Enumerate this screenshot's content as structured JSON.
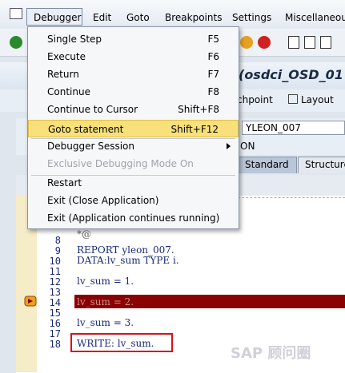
{
  "menubar": {
    "items": [
      "Debugger",
      "Edit",
      "Goto",
      "Breakpoints",
      "Settings",
      "Miscellaneous"
    ]
  },
  "title": {
    "text": "(osdci_OSD_01"
  },
  "appbar": {
    "watchpoint": "chpoint",
    "layout": "Layout"
  },
  "fields": {
    "program_value": "YLEON_007",
    "session_value": "ON"
  },
  "tabs": [
    "Standard",
    "Structure"
  ],
  "dropdown": {
    "items": [
      {
        "label": "Single Step",
        "shortcut": "F5"
      },
      {
        "label": "Execute",
        "shortcut": "F6"
      },
      {
        "label": "Return",
        "shortcut": "F7"
      },
      {
        "label": "Continue",
        "shortcut": "F8"
      },
      {
        "label": "Continue to Cursor",
        "shortcut": "Shift+F8"
      },
      {
        "label": "Goto statement",
        "shortcut": "Shift+F12"
      },
      {
        "label": "Debugger Session",
        "shortcut": ""
      },
      {
        "label": "Exclusive Debugging Mode On",
        "shortcut": ""
      },
      {
        "label": "Restart",
        "shortcut": ""
      },
      {
        "label": "Exit (Close Application)",
        "shortcut": ""
      },
      {
        "label": "Exit (Application continues running)",
        "shortcut": ""
      }
    ],
    "selected_index": 5
  },
  "code": {
    "lines": [
      {
        "num": "",
        "text": "*@"
      },
      {
        "num": "8",
        "text": ""
      },
      {
        "num": "9",
        "text": "REPORT yleon_007."
      },
      {
        "num": "10",
        "text": "DATA:lv_sum TYPE i."
      },
      {
        "num": "11",
        "text": ""
      },
      {
        "num": "12",
        "text": "lv_sum = 1."
      },
      {
        "num": "13",
        "text": ""
      },
      {
        "num": "14",
        "text": "lv_sum = 2."
      },
      {
        "num": "15",
        "text": ""
      },
      {
        "num": "16",
        "text": "lv_sum = 3."
      },
      {
        "num": "17",
        "text": ""
      },
      {
        "num": "18",
        "text": "WRITE: lv_sum."
      }
    ],
    "current_line": "14"
  },
  "watermark": "SAP 顾问圈",
  "colors": {
    "highlight": "#8b0000",
    "selected_menu": "#f8e07a",
    "red_box": "#d8101a"
  }
}
